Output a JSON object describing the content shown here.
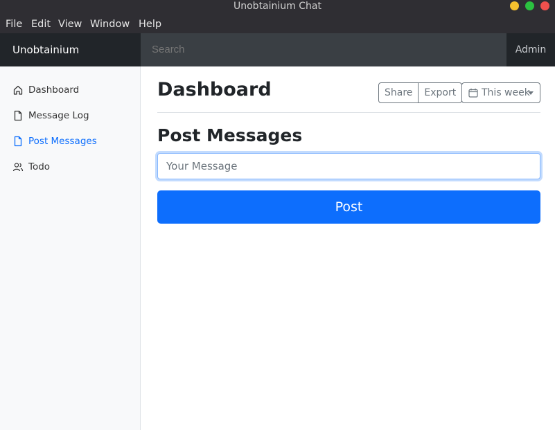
{
  "window": {
    "title": "Unobtainium Chat"
  },
  "menu": {
    "items": [
      "File",
      "Edit",
      "View",
      "Window",
      "Help"
    ]
  },
  "navbar": {
    "brand": "Unobtainium",
    "search_placeholder": "Search",
    "user": "Admin"
  },
  "sidebar": {
    "items": [
      {
        "label": "Dashboard",
        "icon": "home-icon",
        "active": false
      },
      {
        "label": "Message Log",
        "icon": "file-icon",
        "active": false
      },
      {
        "label": "Post Messages",
        "icon": "file-icon",
        "active": true
      },
      {
        "label": "Todo",
        "icon": "users-icon",
        "active": false
      }
    ]
  },
  "header": {
    "title": "Dashboard",
    "share_label": "Share",
    "export_label": "Export",
    "range_label": "This week",
    "range_icon": "calendar-icon"
  },
  "post": {
    "title": "Post Messages",
    "input_placeholder": "Your Message",
    "input_value": "",
    "button_label": "Post"
  },
  "colors": {
    "primary": "#0d6efd",
    "navbar": "#343a40",
    "brand_bg": "#212529",
    "sidebar_bg": "#f8f9fa"
  }
}
